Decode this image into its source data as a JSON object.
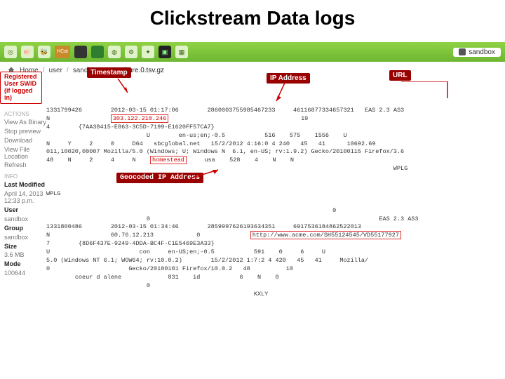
{
  "page_title": "Clickstream Data logs",
  "topbar": {
    "icons": [
      "leaf",
      "pig",
      "bee",
      "hcat",
      "dbblk",
      "dbgrn",
      "globe",
      "gear",
      "tools",
      "term",
      "grid"
    ],
    "hcat_label": "HCat",
    "user_label": "sandbox"
  },
  "breadcrumb": {
    "home": "Home",
    "parts": [
      "user",
      "sandbox"
    ],
    "file": "Omniture.0.tsv.gz"
  },
  "annotations": {
    "timestamp": "Timestamp",
    "ip_address": "IP Address",
    "url": "URL",
    "swid": "Registered User SWID (if logged in)",
    "geocoded": "Geocoded IP Address"
  },
  "sidebar": {
    "actions_title": "ACTIONS",
    "actions": [
      "View As Binary",
      "Stop preview",
      "Download",
      "View File Location",
      "Refresh"
    ],
    "info_title": "INFO",
    "last_modified_label": "Last Modified",
    "last_modified_value": "April 14, 2013 12:33 p.m.",
    "user_label": "User",
    "user_value": "sandbox",
    "group_label": "Group",
    "group_value": "sandbox",
    "size_label": "Size",
    "size_value": "3.6 MB",
    "mode_label": "Mode",
    "mode_value": "100644"
  },
  "log": {
    "r1": {
      "c1": "1331799426",
      "c2": "2012-03-15 01:17:06",
      "c3": "2860003755985467233",
      "c4": "46116877334657321",
      "c5": "EAS 2.3 AS3"
    },
    "r2": {
      "c1": "N",
      "c2": "303.122.210.246",
      "c3": "19"
    },
    "r3": {
      "c1": "4",
      "c2": "{7AA38415-E863-3C5D-7199-E1620FF57CA7}"
    },
    "r4": {
      "c1": "U",
      "c2": "en-us;en;-0.5",
      "c3": "516",
      "c4": "575",
      "c5": "1556",
      "c6": "U"
    },
    "r5": {
      "c1": "N",
      "c2": "Y",
      "c3": "2",
      "c4": "0",
      "c5": "D64",
      "c6": "sbcglobal.net",
      "c7": "15/2/2012 4:16:0 4 240",
      "c8": "45",
      "c9": "41",
      "c10": "10692.69"
    },
    "r6": {
      "c1": "011,10020,00007 Mozilla/5.0 (Windows; U; Windows N  6.1, en-US; rv:1.9.2) Gecko/20100115 Firefox/3.6"
    },
    "r7": {
      "c1": "48",
      "c2": "N",
      "c3": "2",
      "c4": "4",
      "c5": "N",
      "c6": "homestead",
      "c7": "usa",
      "c8": "528",
      "c9": "4",
      "c10": "N",
      "c11": "N"
    },
    "r8": {
      "c1": "0",
      "c2": "WPLG"
    },
    "r9": {
      "c1": "WPLG"
    },
    "r10": {
      "c1": "0"
    },
    "r11": {
      "c1": "0"
    },
    "r12": {
      "c1": "0",
      "c2": "EAS 2.3 AS3"
    },
    "r13": {
      "c1": "1331800486",
      "c2": "2012-03-15 01:34:46",
      "c3": "2859997626193634351",
      "c4": "6917536184862522013"
    },
    "r14": {
      "c1": "N",
      "c2": "60.76.12.213",
      "c3": "0",
      "c4": "http://www.acme.com/SH55124545/VD55177927"
    },
    "r15": {
      "c1": "7",
      "c2": "{8D6F437E-9249-4DDA-BC4F-C1E5469E3A33}"
    },
    "r16": {
      "c1": "U",
      "c2": "con",
      "c3": "en-US;en;-0.5",
      "c4": "591",
      "c5": "0",
      "c6": "6",
      "c7": "U"
    },
    "r17": {
      "c1": "5.0 (Windows NT 6.1; WOW64; rv:10.0.2)",
      "c2": "15/2/2012 1:7:2 4 420",
      "c3": "45",
      "c4": "41",
      "c5": "Mozilla/"
    },
    "r18": {
      "c1": "0",
      "c2": "Gecko/20100101 Firefox/10.0.2",
      "c3": "48",
      "c4": "10"
    },
    "r19": {
      "c1": "coeur d alene",
      "c2": "831",
      "c3": "id",
      "c4": "6",
      "c5": "N",
      "c6": "0"
    },
    "r20": {
      "c1": "0"
    },
    "r21": {
      "c1": "KXLY"
    }
  }
}
